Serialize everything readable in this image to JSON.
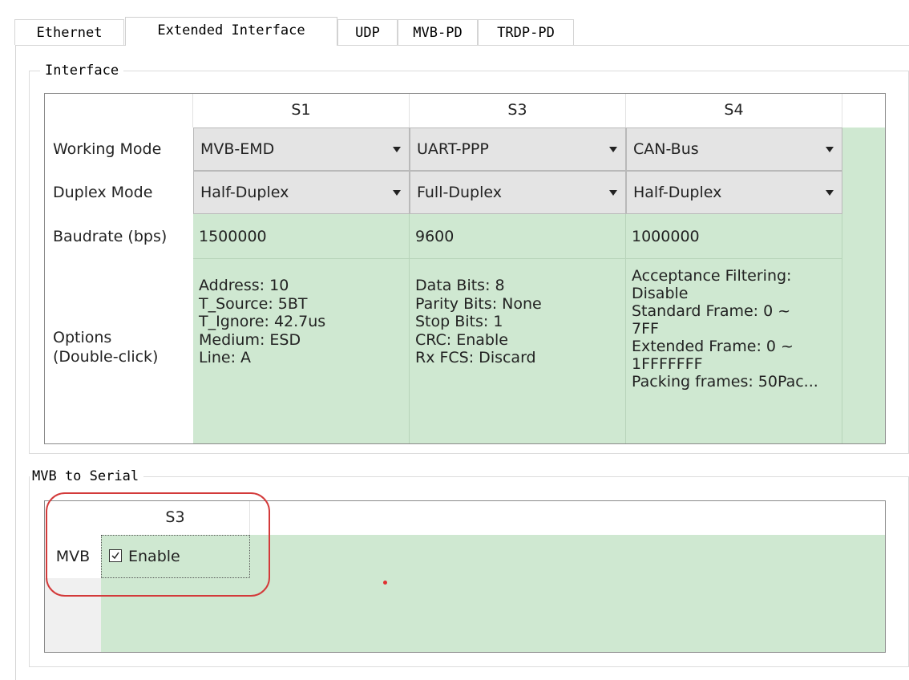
{
  "tabs": [
    {
      "label": "Ethernet",
      "active": false
    },
    {
      "label": "Extended Interface",
      "active": true
    },
    {
      "label": "UDP",
      "active": false
    },
    {
      "label": "MVB-PD",
      "active": false
    },
    {
      "label": "TRDP-PD",
      "active": false
    }
  ],
  "interface_group": {
    "title": "Interface",
    "columns": [
      "S1",
      "S3",
      "S4"
    ],
    "rows": {
      "working_mode": {
        "label": "Working Mode",
        "values": [
          "MVB-EMD",
          "UART-PPP",
          "CAN-Bus"
        ]
      },
      "duplex_mode": {
        "label": "Duplex Mode",
        "values": [
          "Half-Duplex",
          "Full-Duplex",
          "Half-Duplex"
        ]
      },
      "baudrate": {
        "label": "Baudrate (bps)",
        "values": [
          "1500000",
          "9600",
          "1000000"
        ]
      },
      "options": {
        "label_line1": "Options",
        "label_line2": "(Double-click)",
        "s1": [
          "Address: 10",
          "T_Source: 5BT",
          "T_Ignore: 42.7us",
          "Medium: ESD",
          "Line: A"
        ],
        "s3": [
          "Data Bits: 8",
          "Parity Bits: None",
          "Stop Bits: 1",
          "CRC: Enable",
          "Rx FCS: Discard"
        ],
        "s4": [
          "Acceptance Filtering:",
          "Disable",
          "Standard Frame: 0 ~",
          "7FF",
          "Extended Frame: 0 ~",
          "1FFFFFFF",
          "Packing frames: 50Pac..."
        ]
      }
    }
  },
  "mvb_serial_group": {
    "title": "MVB to Serial",
    "column": "S3",
    "row_label": "MVB",
    "checkbox_label": "Enable",
    "checkbox_checked": true
  },
  "colors": {
    "cell_green": "#cfe8d1",
    "annotation_red": "#d33a3a"
  }
}
